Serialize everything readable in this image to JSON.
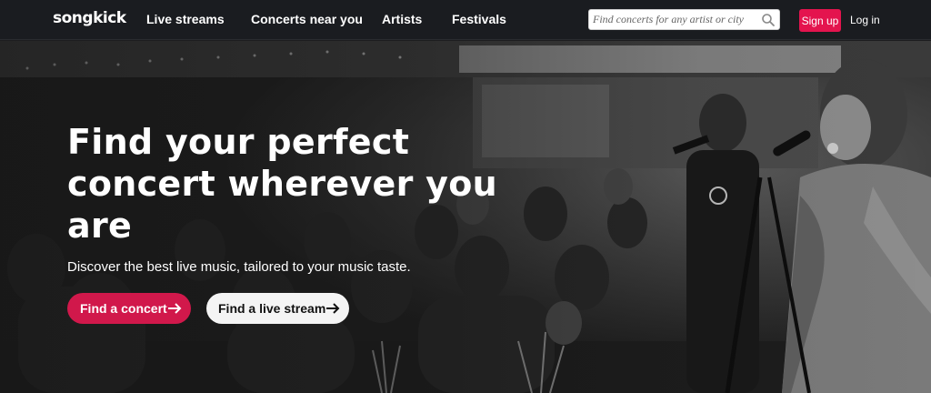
{
  "nav": {
    "logo": "songkick",
    "links": [
      "Live streams",
      "Concerts near you",
      "Artists",
      "Festivals"
    ],
    "search_placeholder": "Find concerts for any artist or city",
    "signup": "Sign up",
    "login": "Log in"
  },
  "hero": {
    "headline_lines": [
      "Find your perfect",
      "concert wherever you",
      "are"
    ],
    "subhead": "Discover the best live music, tailored to your music taste.",
    "primary_button": "Find a concert",
    "secondary_button": "Find a live stream"
  },
  "colors": {
    "nav_bg": "#1a1c20",
    "accent": "#e4144e",
    "button_primary": "#d1184b",
    "button_secondary": "#f4f4f4"
  },
  "icons": [
    "search-icon",
    "arrow-right-icon"
  ]
}
